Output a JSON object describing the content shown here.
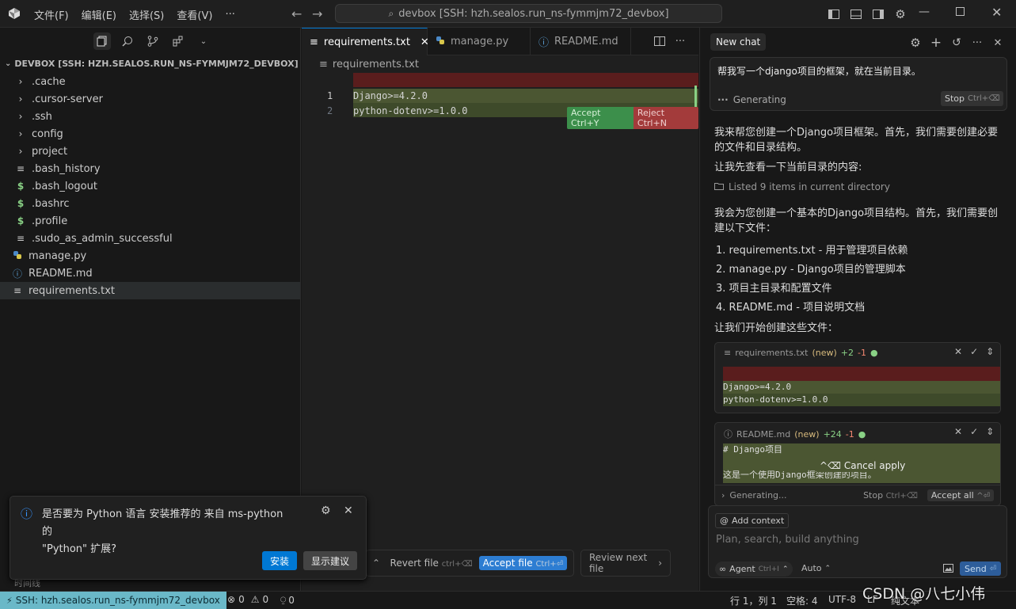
{
  "titlebar": {
    "menus": [
      "文件(F)",
      "编辑(E)",
      "选择(S)",
      "查看(V)",
      "···"
    ],
    "search_text": "devbox [SSH: hzh.sealos.run_ns-fymmjm72_devbox]"
  },
  "sidebar": {
    "root": "DEVBOX [SSH: HZH.SEALOS.RUN_NS-FYMMJM72_DEVBOX]",
    "items": [
      {
        "label": ".cache",
        "kind": "folder"
      },
      {
        "label": ".cursor-server",
        "kind": "folder"
      },
      {
        "label": ".ssh",
        "kind": "folder"
      },
      {
        "label": "config",
        "kind": "folder"
      },
      {
        "label": "project",
        "kind": "folder"
      },
      {
        "label": ".bash_history",
        "kind": "text"
      },
      {
        "label": ".bash_logout",
        "kind": "shell"
      },
      {
        "label": ".bashrc",
        "kind": "shell"
      },
      {
        "label": ".profile",
        "kind": "shell"
      },
      {
        "label": ".sudo_as_admin_successful",
        "kind": "text"
      },
      {
        "label": "manage.py",
        "kind": "python"
      },
      {
        "label": "README.md",
        "kind": "info"
      },
      {
        "label": "requirements.txt",
        "kind": "text",
        "selected": true
      }
    ],
    "bottom_partial": "时间线"
  },
  "editor": {
    "tabs": [
      {
        "label": "requirements.txt",
        "active": true
      },
      {
        "label": "manage.py",
        "active": false
      },
      {
        "label": "README.md",
        "active": false
      }
    ],
    "breadcrumb": "requirements.txt",
    "lines": [
      {
        "num": "1",
        "text": "Django>=4.2.0"
      },
      {
        "num": "2",
        "text": "python-dotenv>=1.0.0"
      }
    ],
    "accept_label": "Accept",
    "accept_kbd": "Ctrl+Y",
    "reject_label": "Reject",
    "reject_kbd": "Ctrl+N",
    "bottom": {
      "revert": "Revert file",
      "revert_kbd": "ctrl+⌫",
      "accept": "Accept file",
      "accept_kbd": "Ctrl+⏎",
      "review": "Review next file"
    }
  },
  "notification": {
    "text_line1": "是否要为 Python 语言 安装推荐的 来自 ms-python 的",
    "text_line2": "\"Python\" 扩展?",
    "install": "安装",
    "show": "显示建议"
  },
  "chat": {
    "tab": "New chat",
    "user_message": "帮我写一个django项目的框架，就在当前目录。",
    "generating": "Generating",
    "stop": "Stop",
    "stop_kbd": "Ctrl+⌫",
    "p1": "我来帮您创建一个Django项目框架。首先，我们需要创建必要的文件和目录结构。",
    "p2": "让我先查看一下当前目录的内容:",
    "listed": "Listed 9 items in current directory",
    "p3": "我会为您创建一个基本的Django项目结构。首先，我们需要创建以下文件：",
    "list": [
      "1. requirements.txt - 用于管理项目依赖",
      "2. manage.py - Django项目的管理脚本",
      "3. 项目主目录和配置文件",
      "4. README.md - 项目说明文档"
    ],
    "p4": "让我们开始创建这些文件：",
    "card1": {
      "file": "requirements.txt",
      "tag": "(new)",
      "plus": "+2",
      "minus": "-1",
      "lines": [
        "Django>=4.2.0",
        "python-dotenv>=1.0.0"
      ]
    },
    "card2": {
      "file": "README.md",
      "tag": "(new)",
      "plus": "+24",
      "minus": "-1",
      "lines": [
        "# Django项目",
        "",
        "这是一个使用Django框架创建的项目。"
      ],
      "cancel": "^⌫ Cancel apply"
    },
    "gen_bar": {
      "label": "Generating...",
      "stop": "Stop",
      "stop_kbd": "Ctrl+⌫",
      "accept_all": "Accept all",
      "accept_all_kbd": "^⏎"
    },
    "input": {
      "add_context": "Add context",
      "placeholder": "Plan, search, build anything",
      "agent": "Agent",
      "agent_kbd": "Ctrl+I",
      "auto": "Auto",
      "send": "Send",
      "send_kbd": "⏎"
    }
  },
  "statusbar": {
    "remote": "SSH: hzh.sealos.run_ns-fymmjm72_devbox",
    "errors": "0",
    "warnings": "0",
    "ports": "0",
    "position": "行 1，列 1",
    "spaces": "空格: 4",
    "encoding": "UTF-8",
    "eol": "LF",
    "language": "纯文本",
    "watermark": "CSDN @八七小伟"
  },
  "colors": {
    "accent": "#0078d4",
    "remote_bg": "#6ab8c8",
    "diff_red": "#5a1d1d",
    "diff_green": "#4b5632",
    "btn_blue": "#2d7dd2"
  }
}
